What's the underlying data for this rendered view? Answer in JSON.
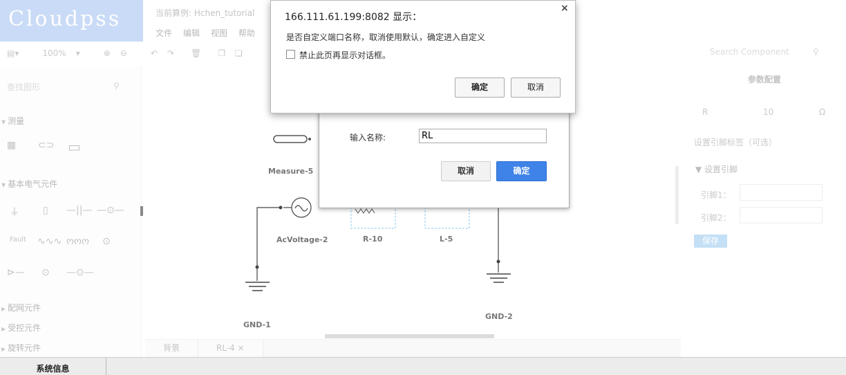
{
  "app": {
    "logo": "Cloudpss",
    "title": "当前算例: Hchen_tutorial",
    "menu": [
      "文件",
      "编辑",
      "视图",
      "帮助"
    ],
    "zoom": "100%"
  },
  "left": {
    "search_placeholder": "查找图形",
    "sections": [
      "测量",
      "基本电气元件",
      "配网元件",
      "受控元件",
      "旋转元件"
    ],
    "fault_label": "Fault"
  },
  "canvas": {
    "labels": {
      "measure": "Measure-5",
      "acvoltage": "AcVoltage-2",
      "r": "R-10",
      "l": "L-5",
      "gnd1": "GND-1",
      "gnd2": "GND-2"
    },
    "tabs": [
      "背景",
      "RL-4"
    ],
    "close_glyph": "×"
  },
  "right": {
    "search_placeholder": "Search Component",
    "param_header": "参数配置",
    "param_name": "R",
    "param_value": "10",
    "param_unit": "Ω",
    "pin_tag_label": "设置引脚标签（可选）",
    "pin_section": "设置引脚",
    "pin1": "引脚1：",
    "pin2": "引脚2：",
    "save": "保存"
  },
  "bottom": {
    "tab": "系统信息"
  },
  "dialog": {
    "label": "输入名称:",
    "value": "RL",
    "cancel": "取消",
    "ok": "确定"
  },
  "alert": {
    "title": "166.111.61.199:8082 显示：",
    "message": "是否自定义端口名称，取消使用默认，确定进入自定义",
    "checkbox_label": "禁止此页再显示对话框。",
    "ok": "确定",
    "cancel": "取消",
    "close": "×"
  }
}
